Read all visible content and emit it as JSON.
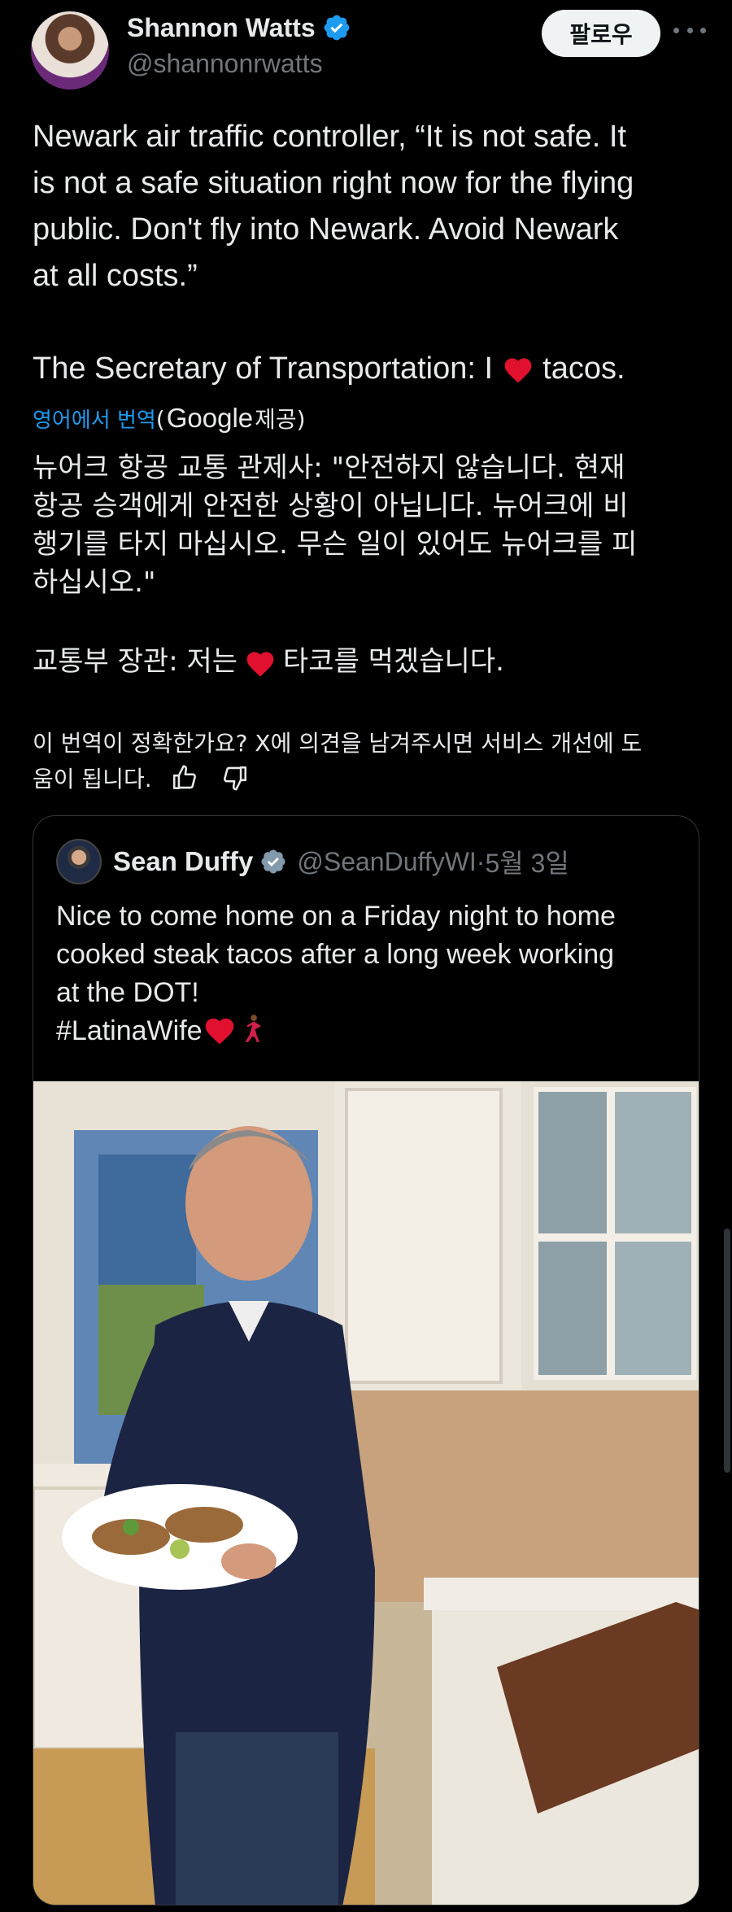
{
  "author": {
    "display_name": "Shannon Watts",
    "handle": "@shannonrwatts"
  },
  "follow_label": "팔로우",
  "tweet": {
    "lines_en_1": [
      "Newark air traffic controller, “It is not safe. It",
      "is not a safe situation right now for the flying",
      "public. Don't fly into Newark. Avoid Newark",
      "at all costs.”"
    ],
    "en_2_before": "The Secretary of Transportation: I ",
    "en_2_after": " tacos."
  },
  "translation": {
    "link_label": "영어에서 번역",
    "provider_open": "(",
    "provider": "Google",
    "provider_close": " 제공)",
    "ko_lines": [
      "뉴어크 항공 교통 관제사: \"안전하지 않습니다. 현재",
      "항공 승객에게 안전한 상황이 아닙니다. 뉴어크에 비",
      "행기를 타지 마십시오. 무슨 일이 있어도 뉴어크를 피",
      "하십시오.\""
    ],
    "ko_2_before": "교통부 장관: 저는",
    "ko_2_after": "타코를 먹겠습니다.",
    "feedback_line1": "이 번역이 정확한가요? X에 의견을 남겨주시면 서비스 개선에 도",
    "feedback_line2": "움이 됩니다."
  },
  "quoted": {
    "display_name": "Sean Duffy",
    "handle": "@SeanDuffyWI",
    "dot": " · ",
    "date": "5월 3일",
    "lines": [
      "Nice to come home on a Friday night to home",
      "cooked steak tacos after a long week working",
      "at the DOT!"
    ],
    "hashtag": "#LatinaWife"
  },
  "colors": {
    "verified": "#1d9bf0",
    "heart": "#f91880",
    "link": "#1d9bf0"
  },
  "icons": [
    "verified-badge-icon",
    "more-icon",
    "heart-emoji-icon",
    "dancer-emoji-icon",
    "thumbs-up-icon",
    "thumbs-down-icon"
  ]
}
